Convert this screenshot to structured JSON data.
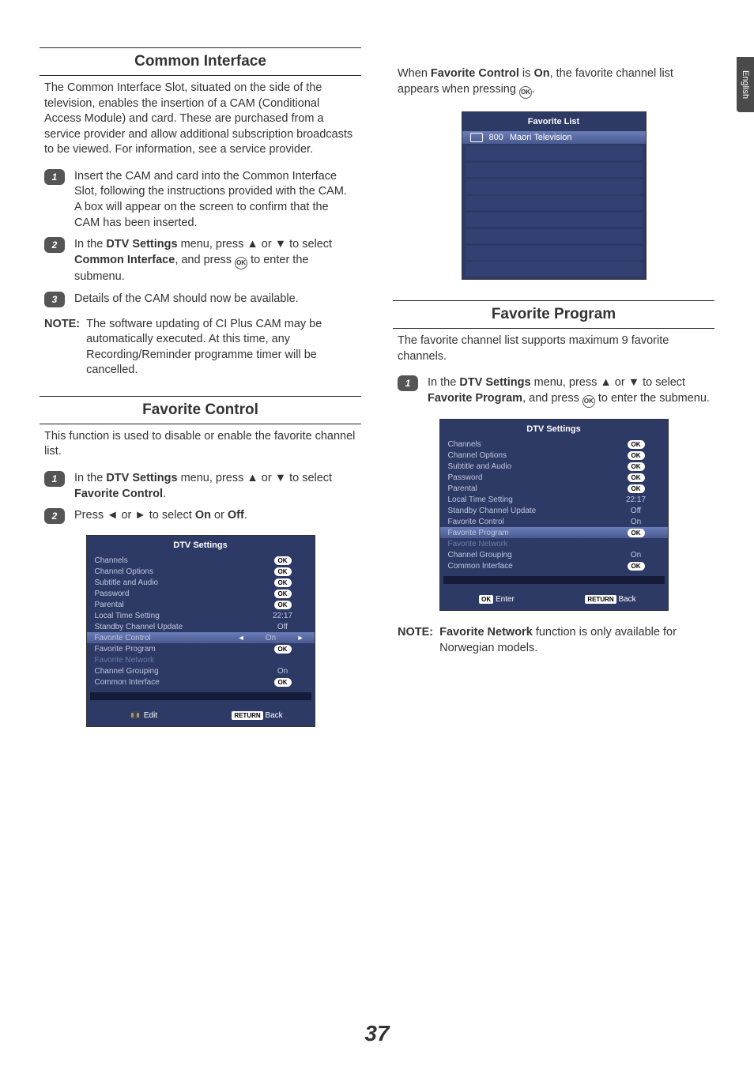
{
  "sideTab": "English",
  "pageNumber": "37",
  "left": {
    "commonInterface": {
      "title": "Common Interface",
      "intro": "The Common Interface Slot, situated on the side of the television, enables the insertion of a CAM (Conditional Access Module) and card. These are purchased from a service provider and allow additional subscription broadcasts to be viewed. For information, see a service provider.",
      "step1": "Insert the CAM and card into the Common Interface Slot, following the instructions provided with the CAM. A box will appear on the screen to confirm that the CAM has been inserted.",
      "step2_a": "In the ",
      "step2_b": "DTV Settings",
      "step2_c": " menu, press ▲ or ▼ to select ",
      "step2_d": "Common Interface",
      "step2_e": ", and press ",
      "step2_ok": "OK",
      "step2_f": " to enter the submenu.",
      "step3": "Details of the CAM should now be available.",
      "noteLabel": "NOTE:",
      "noteText": "The software updating of CI Plus CAM may be automatically executed. At this time, any Recording/Reminder programme timer will be cancelled."
    },
    "favoriteControl": {
      "title": "Favorite Control",
      "intro": "This function is used to disable or enable the favorite channel list.",
      "step1_a": "In the ",
      "step1_b": "DTV Settings",
      "step1_c": " menu, press ▲ or ▼ to select ",
      "step1_d": "Favorite Control",
      "step1_e": ".",
      "step2_a": "Press ◄ or ► to select ",
      "step2_b": "On",
      "step2_c": " or ",
      "step2_d": "Off",
      "step2_e": "."
    },
    "panel1": {
      "title": "DTV Settings",
      "rows": [
        {
          "label": "Channels",
          "value": "OK",
          "type": "pill"
        },
        {
          "label": "Channel Options",
          "value": "OK",
          "type": "pill"
        },
        {
          "label": "Subtitle and Audio",
          "value": "OK",
          "type": "pill"
        },
        {
          "label": "Password",
          "value": "OK",
          "type": "pill"
        },
        {
          "label": "Parental",
          "value": "OK",
          "type": "pill"
        },
        {
          "label": "Local Time Setting",
          "value": "22:17",
          "type": "text"
        },
        {
          "label": "Standby Channel Update",
          "value": "Off",
          "type": "text"
        },
        {
          "label": "Favorite Control",
          "value": "On",
          "type": "highlight"
        },
        {
          "label": "Favorite Program",
          "value": "OK",
          "type": "pill"
        },
        {
          "label": "Favorite Network",
          "value": "",
          "type": "dim"
        },
        {
          "label": "Channel Grouping",
          "value": "On",
          "type": "text"
        },
        {
          "label": "Common Interface",
          "value": "OK",
          "type": "pill"
        }
      ],
      "footerLeft": "Edit",
      "footerReturn": "RETURN",
      "footerBack": "Back"
    }
  },
  "right": {
    "favWhen_a": "When ",
    "favWhen_b": "Favorite Control",
    "favWhen_c": " is ",
    "favWhen_d": "On",
    "favWhen_e": ", the favorite channel list appears when pressing ",
    "favWhen_ok": "OK",
    "favWhen_f": ".",
    "favList": {
      "title": "Favorite List",
      "item_num": "800",
      "item_name": "Maori Television"
    },
    "favoriteProgram": {
      "title": "Favorite Program",
      "intro": "The favorite channel list supports maximum 9 favorite channels.",
      "step1_a": "In the ",
      "step1_b": "DTV Settings",
      "step1_c": " menu, press ▲ or ▼ to select ",
      "step1_d": "Favorite Program",
      "step1_e": ", and press ",
      "step1_ok": "OK",
      "step1_f": " to enter the submenu."
    },
    "panel2": {
      "title": "DTV Settings",
      "rows": [
        {
          "label": "Channels",
          "value": "OK",
          "type": "pill"
        },
        {
          "label": "Channel Options",
          "value": "OK",
          "type": "pill"
        },
        {
          "label": "Subtitle and Audio",
          "value": "OK",
          "type": "pill"
        },
        {
          "label": "Password",
          "value": "OK",
          "type": "pill"
        },
        {
          "label": "Parental",
          "value": "OK",
          "type": "pill"
        },
        {
          "label": "Local Time Setting",
          "value": "22:17",
          "type": "text"
        },
        {
          "label": "Standby Channel Update",
          "value": "Off",
          "type": "text"
        },
        {
          "label": "Favorite Control",
          "value": "On",
          "type": "text"
        },
        {
          "label": "Favorite Program",
          "value": "OK",
          "type": "highlightpill"
        },
        {
          "label": "Favorite Network",
          "value": "",
          "type": "dim"
        },
        {
          "label": "Channel Grouping",
          "value": "On",
          "type": "text"
        },
        {
          "label": "Common Interface",
          "value": "OK",
          "type": "pill"
        }
      ],
      "footerEnterOk": "OK",
      "footerEnter": "Enter",
      "footerReturn": "RETURN",
      "footerBack": "Back"
    },
    "noteLabel": "NOTE:",
    "note_a": "Favorite Network",
    "note_b": " function is only available for Norwegian models."
  }
}
